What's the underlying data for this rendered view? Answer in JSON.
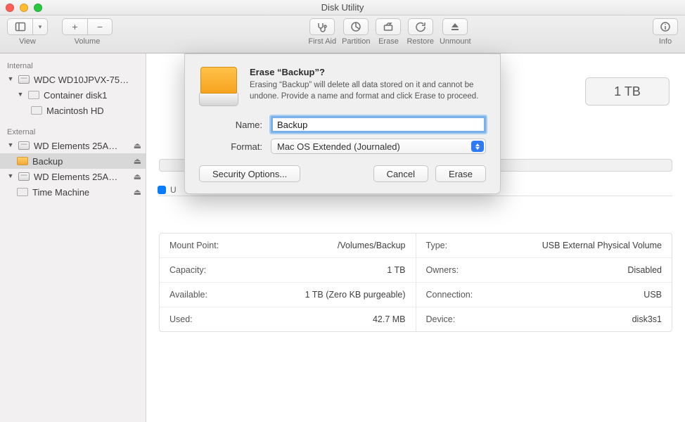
{
  "window": {
    "title": "Disk Utility"
  },
  "toolbar": {
    "view": "View",
    "volume": "Volume",
    "first_aid": "First Aid",
    "partition": "Partition",
    "erase": "Erase",
    "restore": "Restore",
    "unmount": "Unmount",
    "info": "Info"
  },
  "sidebar": {
    "internal_header": "Internal",
    "external_header": "External",
    "internal": [
      {
        "label": "WDC WD10JPVX-75…"
      },
      {
        "label": "Container disk1"
      },
      {
        "label": "Macintosh HD"
      }
    ],
    "external": [
      {
        "label": "WD Elements 25A…"
      },
      {
        "label": "Backup"
      },
      {
        "label": "WD Elements 25A…"
      },
      {
        "label": "Time Machine"
      }
    ]
  },
  "content": {
    "capacity_badge": "1 TB",
    "usage_label": "U"
  },
  "info": {
    "left": [
      {
        "k": "Mount Point:",
        "v": "/Volumes/Backup"
      },
      {
        "k": "Capacity:",
        "v": "1 TB"
      },
      {
        "k": "Available:",
        "v": "1 TB (Zero KB purgeable)"
      },
      {
        "k": "Used:",
        "v": "42.7 MB"
      }
    ],
    "right": [
      {
        "k": "Type:",
        "v": "USB External Physical Volume"
      },
      {
        "k": "Owners:",
        "v": "Disabled"
      },
      {
        "k": "Connection:",
        "v": "USB"
      },
      {
        "k": "Device:",
        "v": "disk3s1"
      }
    ]
  },
  "dialog": {
    "title": "Erase “Backup”?",
    "message": "Erasing “Backup” will delete all data stored on it and cannot be undone. Provide a name and format and click Erase to proceed.",
    "name_label": "Name:",
    "name_value": "Backup",
    "format_label": "Format:",
    "format_value": "Mac OS Extended (Journaled)",
    "security_options": "Security Options...",
    "cancel": "Cancel",
    "erase": "Erase"
  }
}
